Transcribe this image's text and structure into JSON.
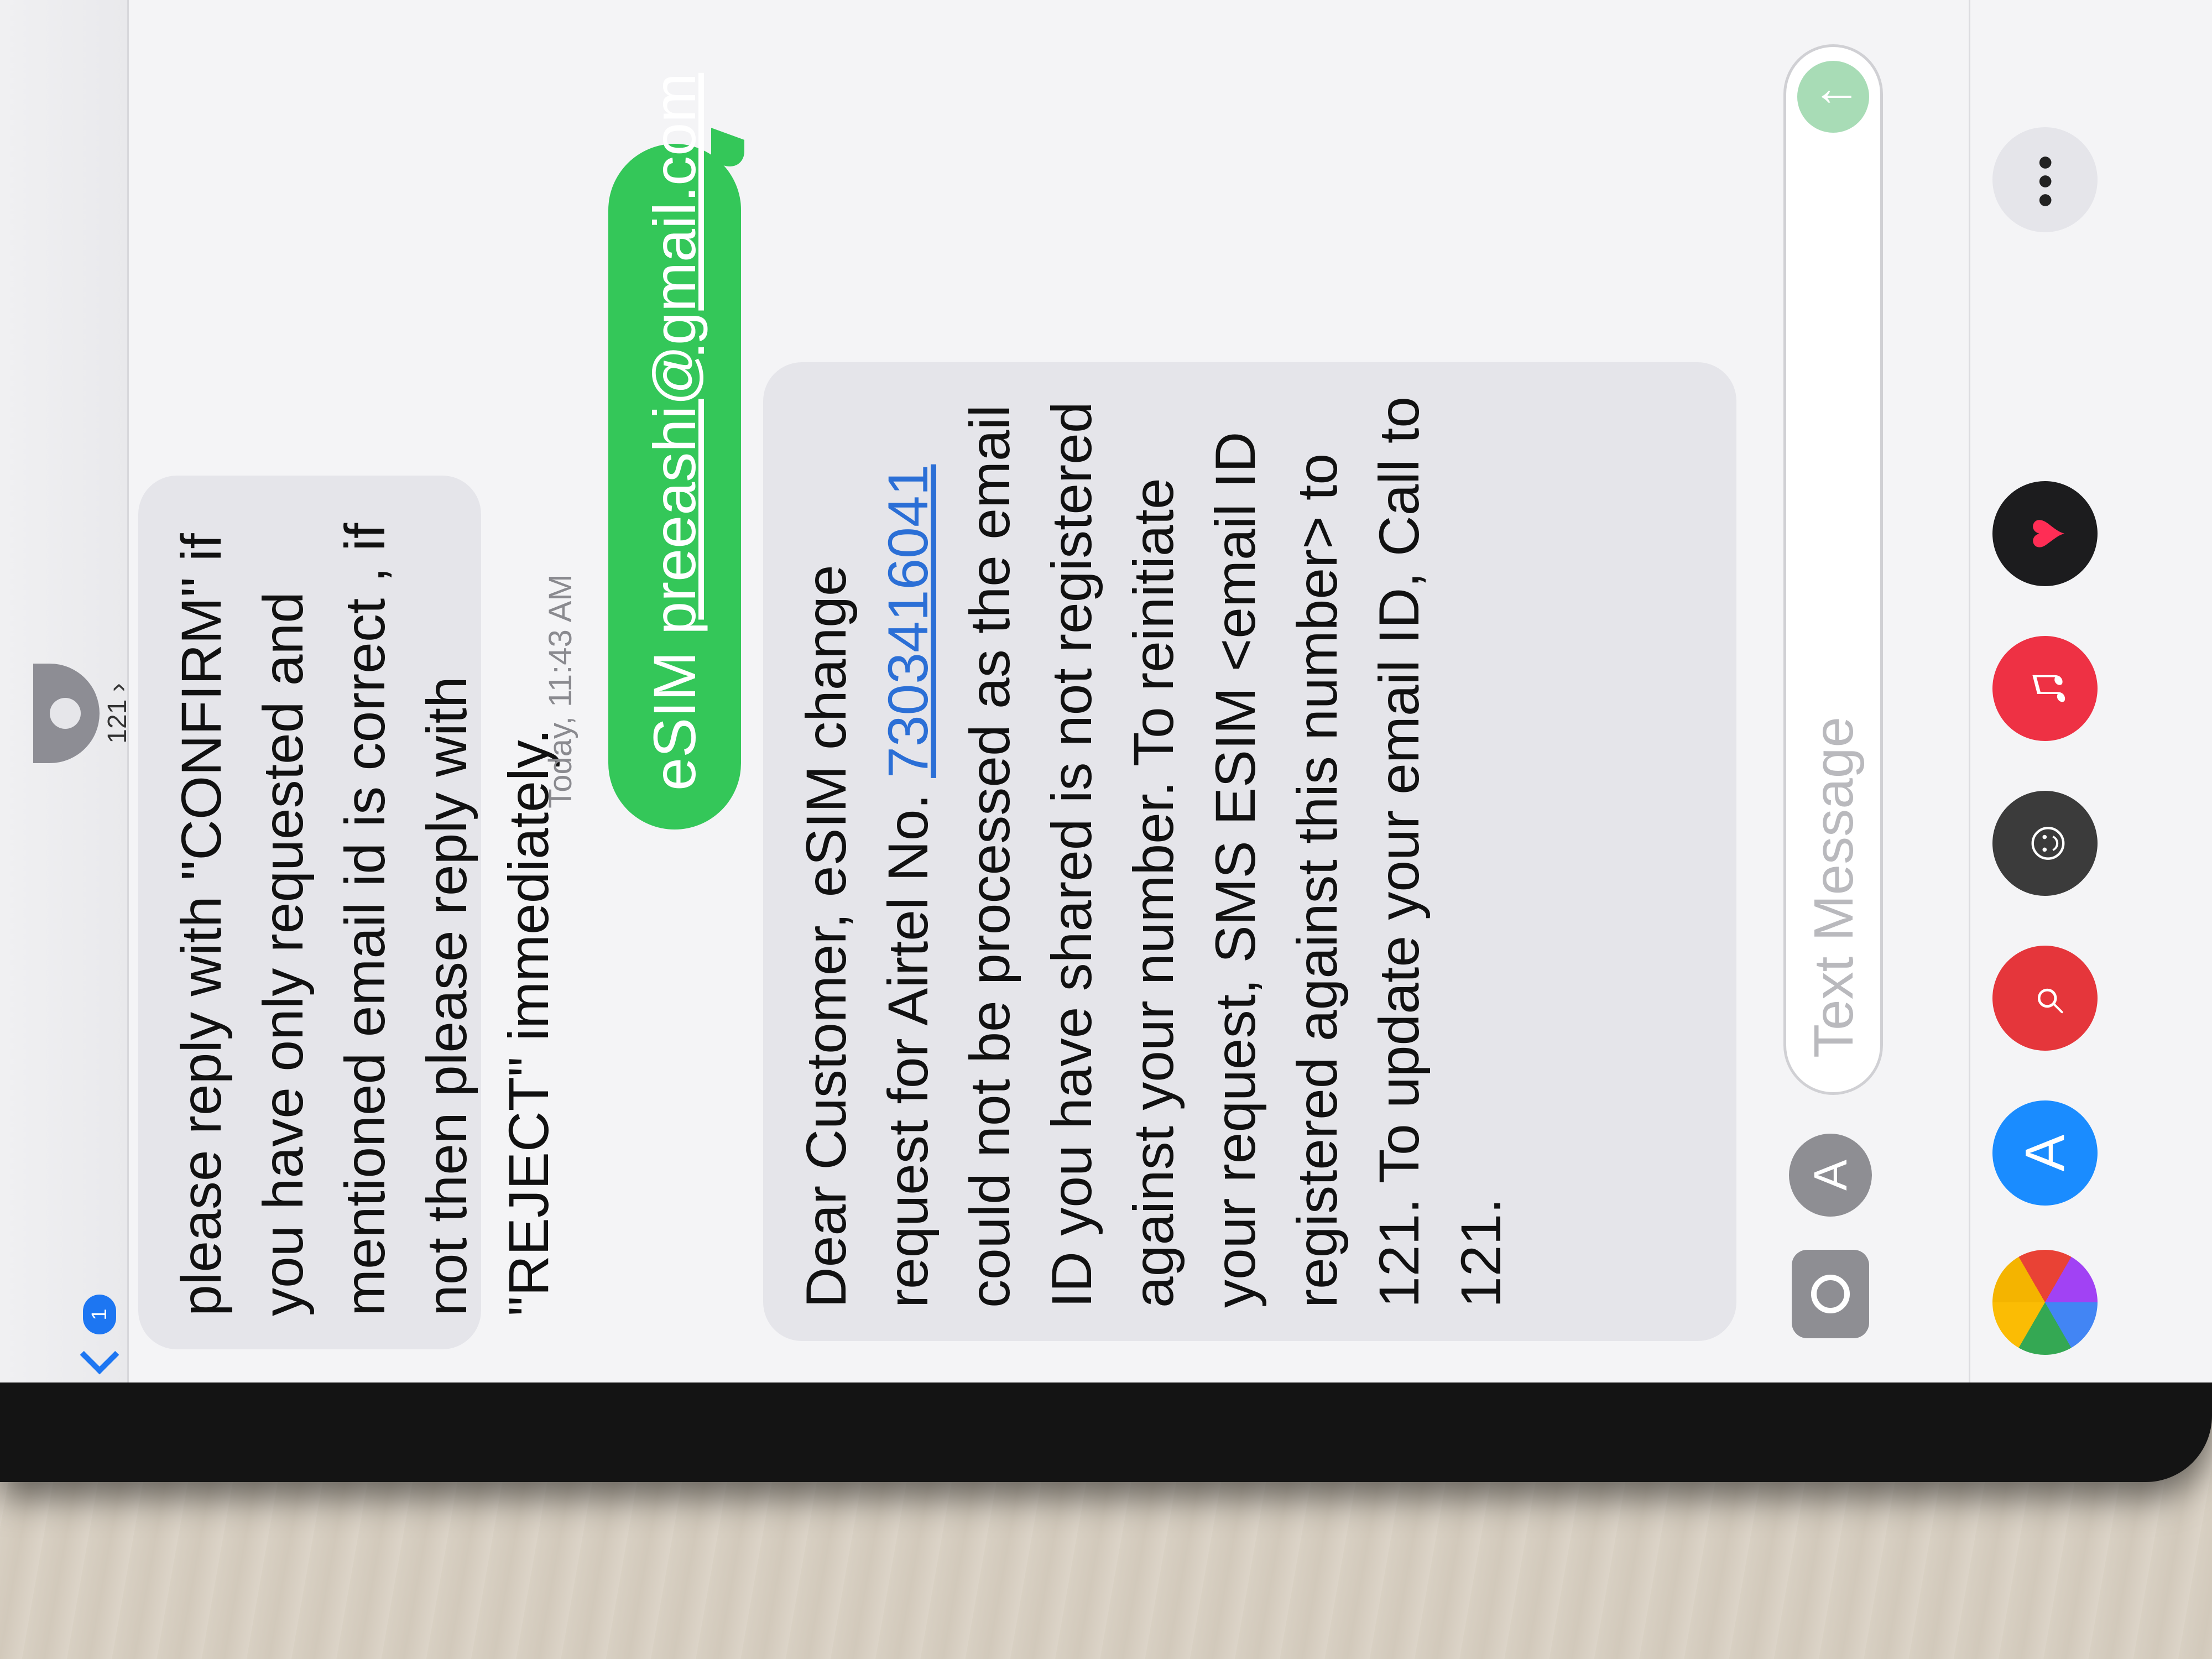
{
  "nav": {
    "back_badge": "1",
    "contact_name": "121 ›"
  },
  "messages": {
    "previous_incoming": "please reply with \"CONFIRM\" if you have only requested and mentioned email id is correct , if not then please reply with \"REJECT\" immediately.",
    "timestamp": "Today, 11:43 AM",
    "outgoing_prefix": "eSIM ",
    "outgoing_email": "preeashi@gmail.com",
    "incoming_part1": "Dear Customer, eSIM change request for Airtel No. ",
    "incoming_number": "7303416041",
    "incoming_part2": " could not be processed as the email ID you have shared is not registered against your number. To reinitiate your request, SMS ESIM <email ID registered against this number> to 121. To update your email ID, Call to 121."
  },
  "compose": {
    "placeholder": "Text Message",
    "send_glyph": "↑",
    "apps_glyph": "A"
  },
  "drawer": {
    "icons": [
      "photos-icon",
      "app-store-icon",
      "web-search-icon",
      "memoji-icon",
      "music-icon",
      "digital-touch-icon",
      "more-icon"
    ],
    "store_glyph": "A",
    "search_glyph": "⌕",
    "memoji_glyph": "☺",
    "music_glyph": "♫",
    "heart_glyph": "♥",
    "more_glyph": "•••"
  },
  "colors": {
    "outgoing_bubble": "#34c759",
    "incoming_bubble": "#e5e5ea",
    "link": "#2b6fd6",
    "accent": "#1d76f2"
  }
}
